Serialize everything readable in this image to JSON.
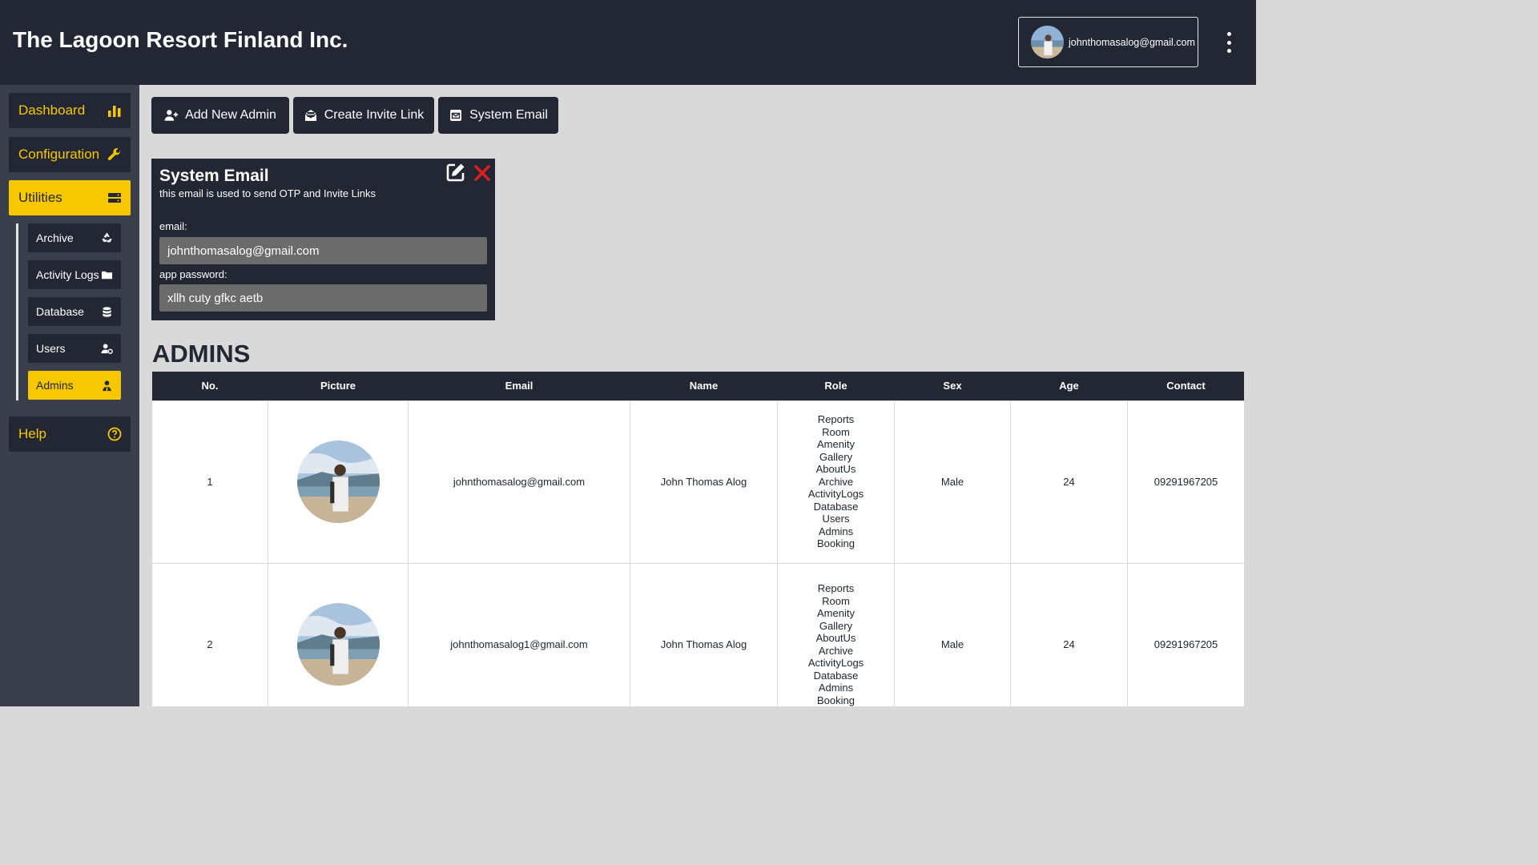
{
  "header": {
    "title": "The Lagoon Resort Finland Inc.",
    "account_email": "johnthomasalog@gmail.com"
  },
  "sidebar": {
    "main": [
      {
        "label": "Dashboard",
        "icon": "bar-chart-icon"
      },
      {
        "label": "Configuration",
        "icon": "wrench-icon"
      },
      {
        "label": "Utilities",
        "icon": "server-icon"
      }
    ],
    "sub": [
      {
        "label": "Archive",
        "icon": "recycle-icon"
      },
      {
        "label": "Activity Logs",
        "icon": "folder-icon"
      },
      {
        "label": "Database",
        "icon": "database-icon"
      },
      {
        "label": "Users",
        "icon": "user-gear-icon"
      },
      {
        "label": "Admins",
        "icon": "user-tie-icon"
      }
    ],
    "help": {
      "label": "Help",
      "icon": "question-circle-icon"
    }
  },
  "toolbar": {
    "add_admin": "Add New Admin",
    "invite_link": "Create Invite Link",
    "system_email": "System Email"
  },
  "system_email_panel": {
    "title": "System Email",
    "subtitle": "this email is used to send OTP and Invite Links",
    "email_label": "email:",
    "email_value": "johnthomasalog@gmail.com",
    "password_label": "app password:",
    "password_value": "xllh cuty gfkc aetb"
  },
  "admins": {
    "title": "ADMINS",
    "columns": [
      "No.",
      "Picture",
      "Email",
      "Name",
      "Role",
      "Sex",
      "Age",
      "Contact"
    ],
    "rows": [
      {
        "no": "1",
        "email": "johnthomasalog@gmail.com",
        "name": "John Thomas Alog",
        "roles": [
          "Reports",
          "Room",
          "Amenity",
          "Gallery",
          "AboutUs",
          "Archive",
          "ActivityLogs",
          "Database",
          "Users",
          "Admins",
          "Booking"
        ],
        "sex": "Male",
        "age": "24",
        "contact": "09291967205"
      },
      {
        "no": "2",
        "email": "johnthomasalog1@gmail.com",
        "name": "John Thomas Alog",
        "roles": [
          "Reports",
          "Room",
          "Amenity",
          "Gallery",
          "AboutUs",
          "Archive",
          "ActivityLogs",
          "Database",
          "Admins",
          "Booking"
        ],
        "sex": "Male",
        "age": "24",
        "contact": "09291967205"
      }
    ]
  },
  "colors": {
    "dark": "#222733",
    "accent": "#f7c800",
    "sidebar_bg": "#3a3f4b",
    "content_bg": "#d9d9d9",
    "close_red": "#e01e1e"
  }
}
